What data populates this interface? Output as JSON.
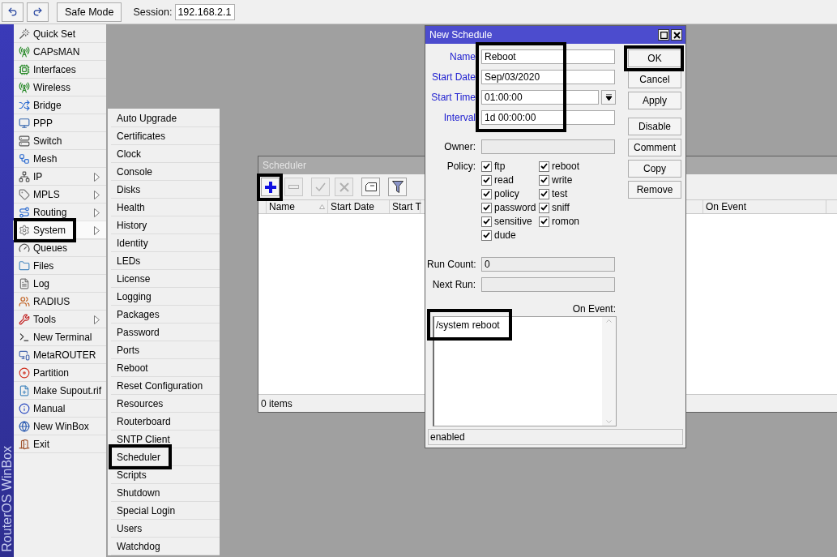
{
  "toolbar": {
    "safe_mode": "Safe Mode",
    "session_label": "Session:",
    "session": "192.168.2.1"
  },
  "side_title": "RouterOS WinBox",
  "menu": [
    {
      "label": "Quick Set",
      "has_submenu": false,
      "selected": false,
      "highlighted": false
    },
    {
      "label": "CAPsMAN",
      "has_submenu": false,
      "selected": false,
      "highlighted": false
    },
    {
      "label": "Interfaces",
      "has_submenu": false,
      "selected": false,
      "highlighted": false
    },
    {
      "label": "Wireless",
      "has_submenu": false,
      "selected": false,
      "highlighted": false
    },
    {
      "label": "Bridge",
      "has_submenu": false,
      "selected": false,
      "highlighted": false
    },
    {
      "label": "PPP",
      "has_submenu": false,
      "selected": false,
      "highlighted": false
    },
    {
      "label": "Switch",
      "has_submenu": false,
      "selected": false,
      "highlighted": false
    },
    {
      "label": "Mesh",
      "has_submenu": false,
      "selected": false,
      "highlighted": false
    },
    {
      "label": "IP",
      "has_submenu": true,
      "selected": false,
      "highlighted": false
    },
    {
      "label": "MPLS",
      "has_submenu": true,
      "selected": false,
      "highlighted": false
    },
    {
      "label": "Routing",
      "has_submenu": true,
      "selected": false,
      "highlighted": false
    },
    {
      "label": "System",
      "has_submenu": true,
      "selected": true,
      "highlighted": true
    },
    {
      "label": "Queues",
      "has_submenu": false,
      "selected": false,
      "highlighted": false
    },
    {
      "label": "Files",
      "has_submenu": false,
      "selected": false,
      "highlighted": false
    },
    {
      "label": "Log",
      "has_submenu": false,
      "selected": false,
      "highlighted": false
    },
    {
      "label": "RADIUS",
      "has_submenu": false,
      "selected": false,
      "highlighted": false
    },
    {
      "label": "Tools",
      "has_submenu": true,
      "selected": false,
      "highlighted": false
    },
    {
      "label": "New Terminal",
      "has_submenu": false,
      "selected": false,
      "highlighted": false
    },
    {
      "label": "MetaROUTER",
      "has_submenu": false,
      "selected": false,
      "highlighted": false
    },
    {
      "label": "Partition",
      "has_submenu": false,
      "selected": false,
      "highlighted": false
    },
    {
      "label": "Make Supout.rif",
      "has_submenu": false,
      "selected": false,
      "highlighted": false
    },
    {
      "label": "Manual",
      "has_submenu": false,
      "selected": false,
      "highlighted": false
    },
    {
      "label": "New WinBox",
      "has_submenu": false,
      "selected": false,
      "highlighted": false
    },
    {
      "label": "Exit",
      "has_submenu": false,
      "selected": false,
      "highlighted": false
    }
  ],
  "submenu": [
    {
      "label": "Auto Upgrade",
      "highlighted": false
    },
    {
      "label": "Certificates",
      "highlighted": false
    },
    {
      "label": "Clock",
      "highlighted": false
    },
    {
      "label": "Console",
      "highlighted": false
    },
    {
      "label": "Disks",
      "highlighted": false
    },
    {
      "label": "Health",
      "highlighted": false
    },
    {
      "label": "History",
      "highlighted": false
    },
    {
      "label": "Identity",
      "highlighted": false
    },
    {
      "label": "LEDs",
      "highlighted": false
    },
    {
      "label": "License",
      "highlighted": false
    },
    {
      "label": "Logging",
      "highlighted": false
    },
    {
      "label": "Packages",
      "highlighted": false
    },
    {
      "label": "Password",
      "highlighted": false
    },
    {
      "label": "Ports",
      "highlighted": false
    },
    {
      "label": "Reboot",
      "highlighted": false
    },
    {
      "label": "Reset Configuration",
      "highlighted": false
    },
    {
      "label": "Resources",
      "highlighted": false
    },
    {
      "label": "Routerboard",
      "highlighted": false
    },
    {
      "label": "SNTP Client",
      "highlighted": false
    },
    {
      "label": "Scheduler",
      "highlighted": true
    },
    {
      "label": "Scripts",
      "highlighted": false
    },
    {
      "label": "Shutdown",
      "highlighted": false
    },
    {
      "label": "Special Login",
      "highlighted": false
    },
    {
      "label": "Users",
      "highlighted": false
    },
    {
      "label": "Watchdog",
      "highlighted": false
    }
  ],
  "scheduler": {
    "title": "Scheduler",
    "active": false,
    "tools": [
      {
        "kind": "add",
        "disabled": false,
        "highlighted": true
      },
      {
        "kind": "remove",
        "disabled": true,
        "highlighted": false
      },
      {
        "kind": "enable",
        "disabled": true,
        "highlighted": false
      },
      {
        "kind": "disable",
        "disabled": true,
        "highlighted": false
      },
      {
        "kind": "comment",
        "disabled": false,
        "highlighted": false
      },
      {
        "kind": "filter",
        "disabled": false,
        "highlighted": false
      }
    ],
    "columns": [
      "Name",
      "Start Date",
      "Start T",
      "On Event"
    ],
    "status": "0 items"
  },
  "dialog": {
    "title": "New Schedule",
    "active": true,
    "fields": [
      {
        "label": "Name",
        "value": "Reboot",
        "kind": "text"
      },
      {
        "label": "Start Date",
        "value": "Sep/03/2020",
        "kind": "text"
      },
      {
        "label": "Start Time",
        "value": "01:00:00",
        "kind": "dropdown"
      },
      {
        "label": "Interval",
        "value": "1d 00:00:00",
        "kind": "text"
      }
    ],
    "fields_highlighted": true,
    "buttons": [
      {
        "label": "OK",
        "highlighted": true
      },
      {
        "label": "Cancel",
        "highlighted": false
      },
      {
        "label": "Apply",
        "highlighted": false
      },
      {
        "label": "Disable",
        "highlighted": false
      },
      {
        "label": "Comment",
        "highlighted": false
      },
      {
        "label": "Copy",
        "highlighted": false
      },
      {
        "label": "Remove",
        "highlighted": false
      }
    ],
    "owner": {
      "label": "Owner:",
      "disabled": true
    },
    "policy": {
      "label": "Policy:",
      "items": [
        {
          "label": "ftp",
          "checked": true
        },
        {
          "label": "reboot",
          "checked": true
        },
        {
          "label": "read",
          "checked": true
        },
        {
          "label": "write",
          "checked": true
        },
        {
          "label": "policy",
          "checked": true
        },
        {
          "label": "test",
          "checked": true
        },
        {
          "label": "password",
          "checked": true
        },
        {
          "label": "sniff",
          "checked": true
        },
        {
          "label": "sensitive",
          "checked": true
        },
        {
          "label": "romon",
          "checked": true
        },
        {
          "label": "dude",
          "checked": true
        }
      ]
    },
    "run_count": {
      "label": "Run Count:",
      "value": "0",
      "disabled": true
    },
    "next_run": {
      "label": "Next Run:",
      "disabled": true
    },
    "on_event": {
      "label": "On Event:",
      "value": "/system reboot",
      "highlighted": true
    },
    "status": "enabled"
  }
}
